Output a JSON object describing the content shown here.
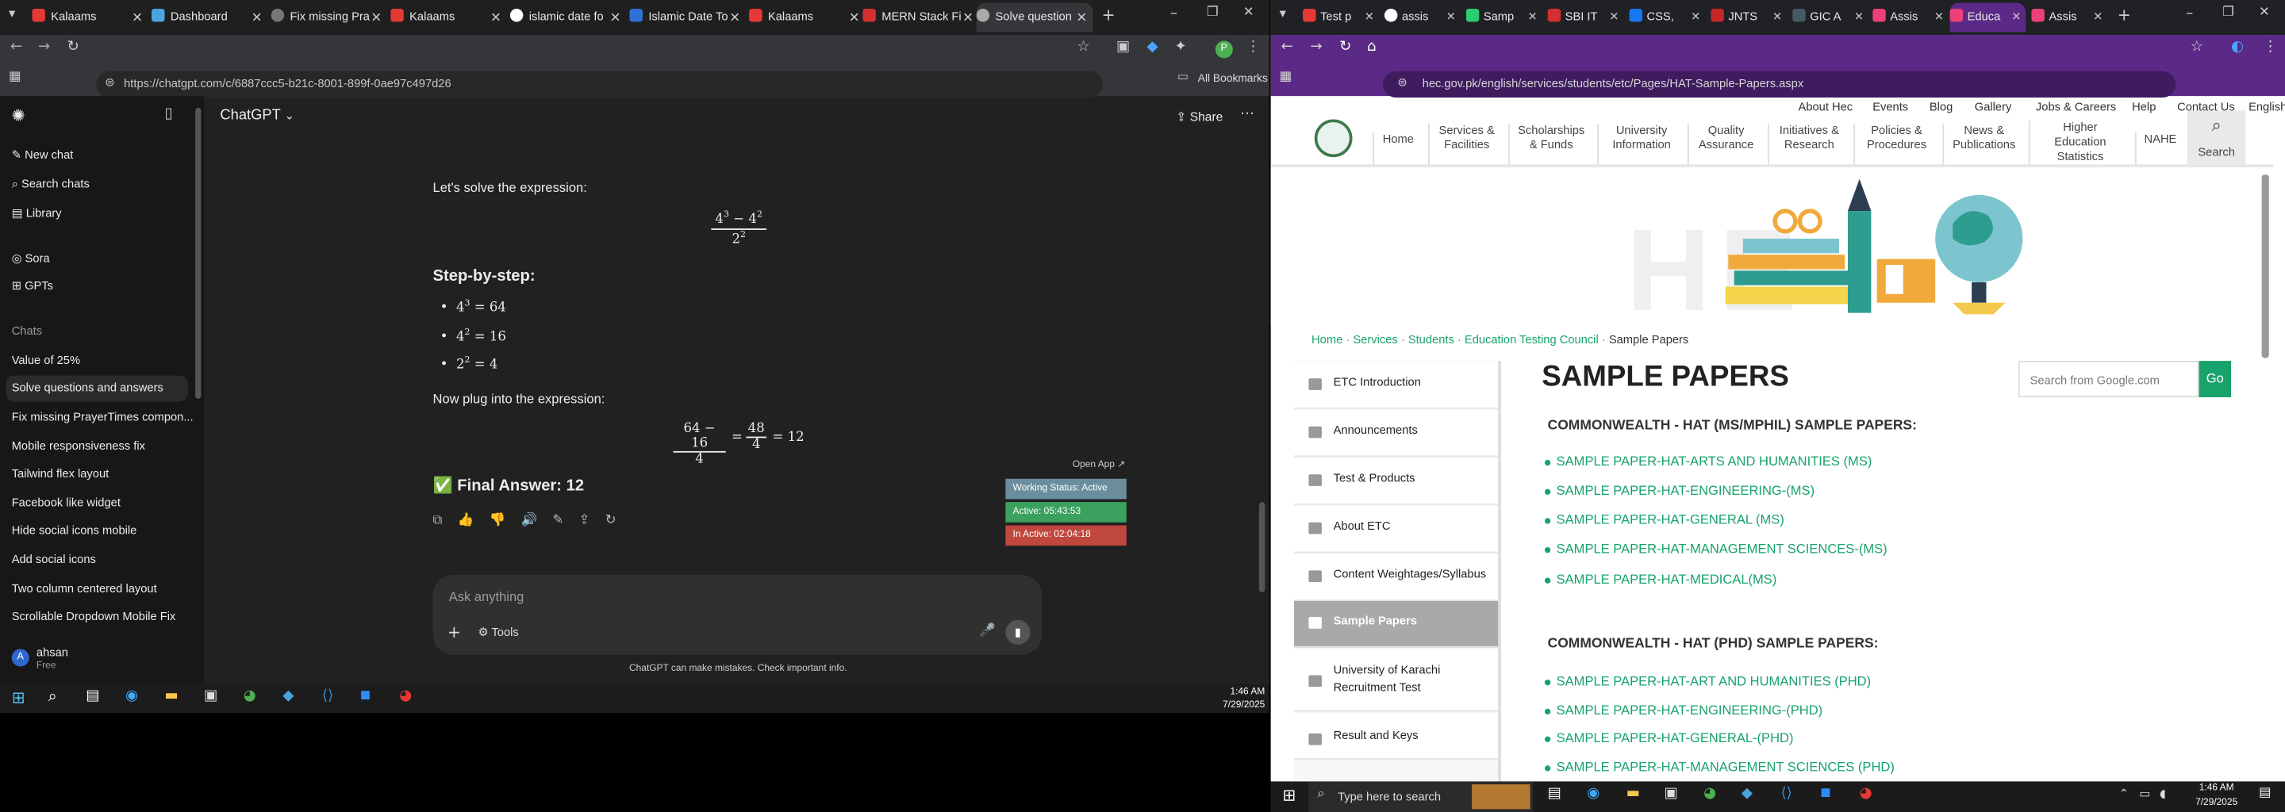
{
  "left_browser": {
    "tabs": [
      {
        "label": "Kalaams",
        "active": false
      },
      {
        "label": "Dashboard",
        "active": false
      },
      {
        "label": "Fix missing Pra",
        "active": false
      },
      {
        "label": "Kalaams",
        "active": false
      },
      {
        "label": "islamic date fo",
        "active": false
      },
      {
        "label": "Islamic Date To",
        "active": false
      },
      {
        "label": "Kalaams",
        "active": false
      },
      {
        "label": "MERN Stack Fi",
        "active": false
      },
      {
        "label": "Solve question",
        "active": true
      }
    ],
    "url": "https://chatgpt.com/c/6887ccc5-b21c-8001-899f-0ae97c497d26",
    "bookmarks_label": "All Bookmarks"
  },
  "chatgpt": {
    "model_label": "ChatGPT",
    "share_label": "Share",
    "sidebar": {
      "top_items": [
        "New chat",
        "Search chats",
        "Library"
      ],
      "app_items": [
        "Sora",
        "GPTs"
      ],
      "section_label": "Chats",
      "chats": [
        "Value of 25%",
        "Solve questions and answers",
        "Fix missing PrayerTimes compon...",
        "Mobile responsiveness fix",
        "Tailwind flex layout",
        "Facebook like widget",
        "Hide social icons mobile",
        "Add social icons",
        "Two column centered layout",
        "Scrollable Dropdown Mobile Fix"
      ],
      "user_name": "ahsan",
      "user_plan": "Free",
      "user_initial": "A"
    },
    "message": {
      "intro": "Let's solve the expression:",
      "expr_num_a": "4",
      "expr_exp_a": "3",
      "expr_minus": "−",
      "expr_num_b": "4",
      "expr_exp_b": "2",
      "expr_den": "2",
      "expr_den_exp": "2",
      "step_heading": "Step-by-step:",
      "steps": [
        {
          "base": "4",
          "exp": "3",
          "rhs": "= 64"
        },
        {
          "base": "4",
          "exp": "2",
          "rhs": "= 16"
        },
        {
          "base": "2",
          "exp": "2",
          "rhs": "= 4"
        }
      ],
      "plug_text": "Now plug into the expression:",
      "frac1_num": "64 − 16",
      "frac1_den": "4",
      "eq1": "=",
      "frac2_num": "48",
      "frac2_den": "4",
      "eq2": "= 12",
      "final_icon": "✅",
      "final_answer": "Final Answer: 12"
    },
    "input_placeholder": "Ask anything",
    "tools_label": "Tools",
    "disclaimer": "ChatGPT can make mistakes. Check important info."
  },
  "overlay_widget": {
    "open_app": "Open App ↗",
    "status": "Working Status: Active",
    "active": "Active: 05:43:53",
    "inactive": "In Active: 02:04:18",
    "colors": {
      "status": "#6b8e9e",
      "active": "#3aa15e",
      "inactive": "#c0473d"
    }
  },
  "left_taskbar": {
    "time": "1:46 AM",
    "date": "7/29/2025"
  },
  "right_browser": {
    "tabs": [
      {
        "label": "Test p",
        "active": false
      },
      {
        "label": "assis",
        "active": false
      },
      {
        "label": "Samp",
        "active": false
      },
      {
        "label": "SBI IT",
        "active": false
      },
      {
        "label": "CSS,",
        "active": false
      },
      {
        "label": "JNTS",
        "active": false
      },
      {
        "label": "GIC A",
        "active": false
      },
      {
        "label": "Assis",
        "active": false
      },
      {
        "label": "Educa",
        "active": true
      },
      {
        "label": "Assis",
        "active": false
      }
    ],
    "url": "hec.gov.pk/english/services/students/etc/Pages/HAT-Sample-Papers.aspx"
  },
  "hec": {
    "top_links": [
      "About Hec",
      "Events",
      "Blog",
      "Gallery",
      "Jobs & Careers",
      "Help",
      "Contact Us",
      "English"
    ],
    "main_nav": [
      "Home",
      "Services &\nFacilities",
      "Scholarships\n& Funds",
      "University\nInformation",
      "Quality\nAssurance",
      "Initiatives &\nResearch",
      "Policies &\nProcedures",
      "News &\nPublications",
      "Higher\nEducation\nStatistics",
      "NAHE",
      "Search"
    ],
    "breadcrumb": [
      "Home",
      "Services",
      "Students",
      "Education Testing Council",
      "Sample Papers"
    ],
    "sidebar": [
      "ETC Introduction",
      "Announcements",
      "Test & Products",
      "About ETC",
      "Content Weightages/Syllabus",
      "Sample Papers",
      "University of Karachi\nRecruitment Test",
      "Result and Keys"
    ],
    "page_title": "SAMPLE PAPERS",
    "search_placeholder": "Search from Google.com",
    "search_button": "Go",
    "section1": "COMMONWEALTH - HAT (MS/MPHIL) SAMPLE PAPERS:",
    "links1": [
      "SAMPLE PAPER-HAT-ARTS AND HUMANITIES (MS)",
      "SAMPLE PAPER-HAT-ENGINEERING-(MS)",
      "SAMPLE PAPER-HAT-GENERAL (MS)",
      "SAMPLE PAPER-HAT-MANAGEMENT SCIENCES-(MS)",
      "SAMPLE PAPER-HAT-MEDICAL(MS)"
    ],
    "section2": "COMMONWEALTH - HAT (PHD) SAMPLE PAPERS:",
    "links2": [
      "SAMPLE PAPER-HAT-ART AND HUMANITIES (PHD)",
      "SAMPLE PAPER-HAT-ENGINEERING-(PHD)",
      "SAMPLE PAPER-HAT-GENERAL-(PHD)",
      "SAMPLE PAPER-HAT-MANAGEMENT SCIENCES (PHD)"
    ],
    "accent": "#17a36b"
  },
  "right_taskbar": {
    "search_placeholder": "Type here to search",
    "time": "1:46 AM",
    "date": "7/29/2025"
  }
}
